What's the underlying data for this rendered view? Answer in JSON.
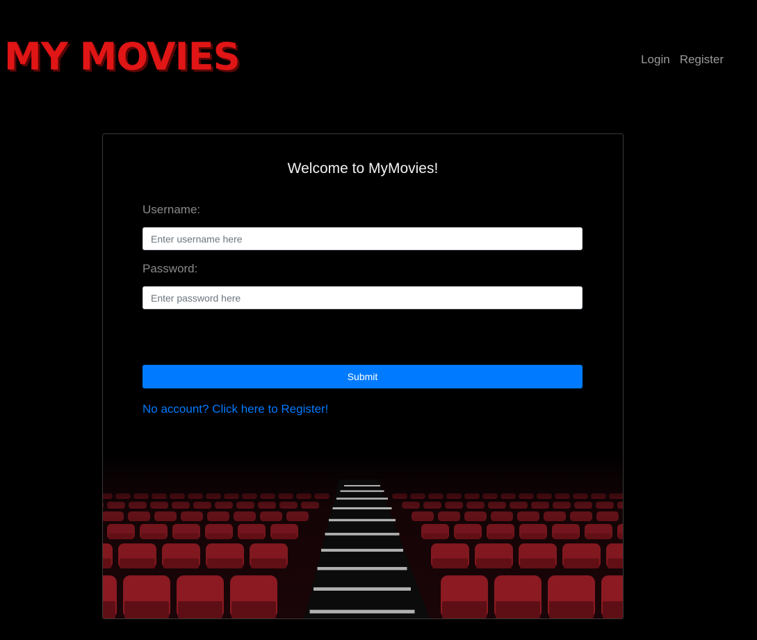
{
  "brand": {
    "title": "MY MOVIES",
    "color": "#e01515"
  },
  "nav": {
    "login": "Login",
    "register": "Register"
  },
  "form": {
    "heading": "Welcome to MyMovies!",
    "username_label": "Username:",
    "username_placeholder": "Enter username here",
    "password_label": "Password:",
    "password_placeholder": "Enter password here",
    "submit_label": "Submit",
    "register_link": "No account? Click here to Register!"
  },
  "colors": {
    "accent": "#007bff",
    "seat_red": "#8b1a22"
  },
  "background_image": "cinema-seats-illustration"
}
